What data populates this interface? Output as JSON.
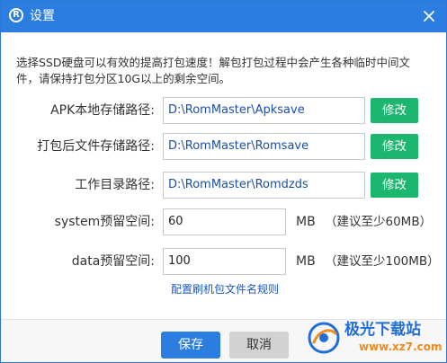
{
  "window": {
    "title": "设置",
    "app_icon_glyph": "R",
    "close_icon": "close-icon"
  },
  "tip": "选择SSD硬盘可以有效的提高打包速度！解包打包过程中会产生各种临时中间文件，请保持打包分区10G以上的剩余空间。",
  "paths": [
    {
      "label": "APK本地存储路径:",
      "value": "D:\\RomMaster\\Apksave",
      "button": "修改"
    },
    {
      "label": "打包后文件存储路径:",
      "value": "D:\\RomMaster\\Romsave",
      "button": "修改"
    },
    {
      "label": "工作目录路径:",
      "value": "D:\\RomMaster\\Romdzds",
      "button": "修改"
    }
  ],
  "reserves": [
    {
      "label": "system预留空间:",
      "value": "60",
      "unit": "MB",
      "hint": "（建议至少60MB）"
    },
    {
      "label": "data预留空间:",
      "value": "100",
      "unit": "MB",
      "hint": "（建议至少100MB）"
    }
  ],
  "rule_link": "配置刷机包文件名规则",
  "footer": {
    "save": "保存",
    "cancel": "取消"
  },
  "watermark": {
    "title": "极光下载站",
    "url": "www.xz7.com"
  },
  "colors": {
    "titlebar": "#2b7de0",
    "modify_button": "#1bb76e",
    "save_button": "#2b7de0",
    "cancel_button": "#d2d2d2",
    "path_text": "#1a4fa8",
    "link": "#1a56c9"
  }
}
